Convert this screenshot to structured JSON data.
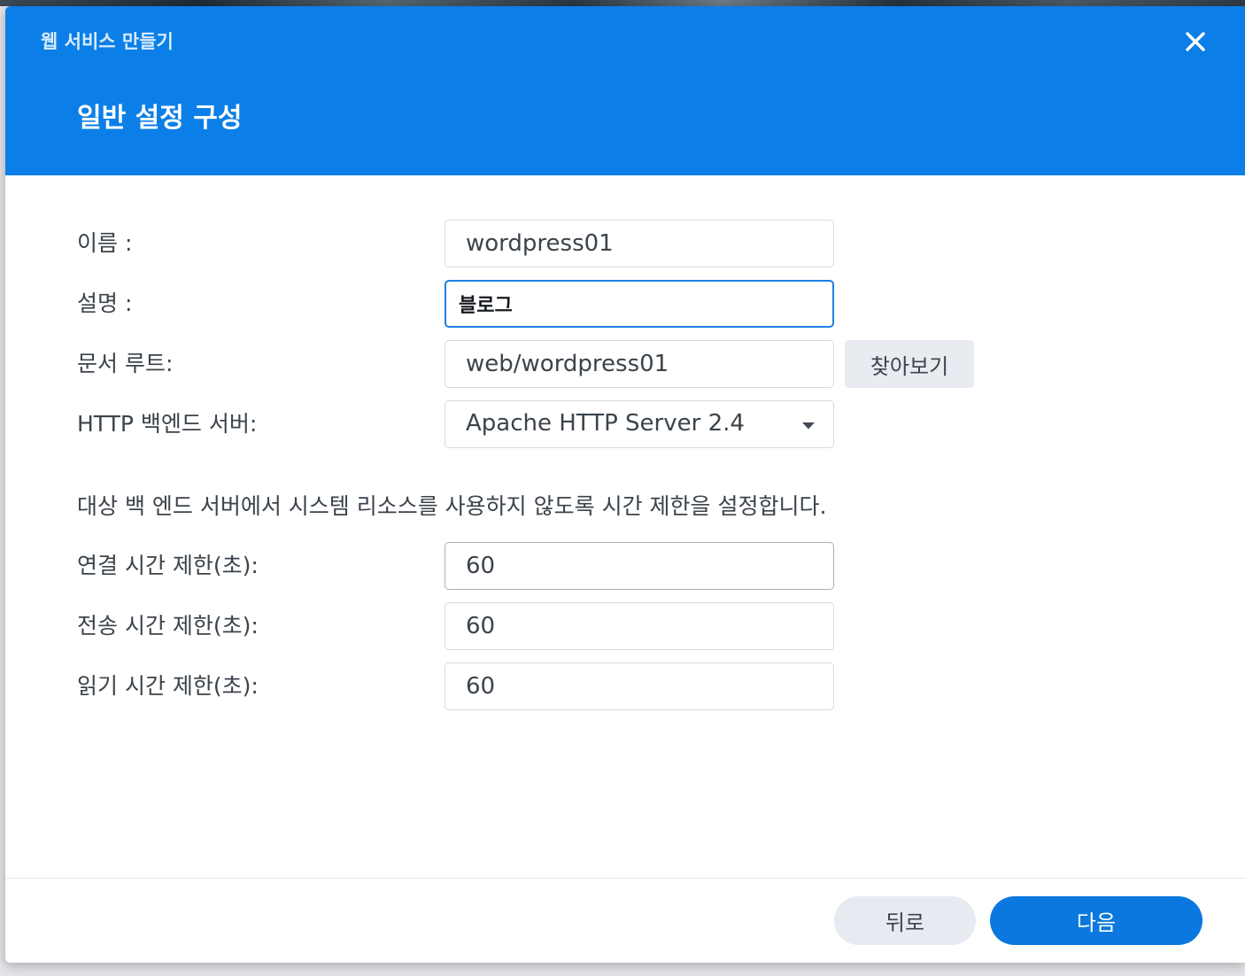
{
  "window": {
    "title": "웹 서비스 만들기"
  },
  "step": {
    "title": "일반 설정 구성"
  },
  "form": {
    "name": {
      "label": "이름 :",
      "value": "wordpress01"
    },
    "description": {
      "label": "설명 :",
      "value": "블로그"
    },
    "document_root": {
      "label": "문서 루트:",
      "value": "web/wordpress01",
      "browse_label": "찾아보기"
    },
    "http_backend": {
      "label": "HTTP 백엔드 서버:",
      "value": "Apache HTTP Server 2.4"
    },
    "timeout_note": "대상 백 엔드 서버에서 시스템 리소스를 사용하지 않도록 시간 제한을 설정합니다.",
    "connect_timeout": {
      "label": "연결 시간 제한(초):",
      "value": "60"
    },
    "send_timeout": {
      "label": "전송 시간 제한(초):",
      "value": "60"
    },
    "read_timeout": {
      "label": "읽기 시간 제한(초):",
      "value": "60"
    }
  },
  "footer": {
    "back_label": "뒤로",
    "next_label": "다음"
  },
  "icons": {
    "close": "close-icon",
    "dropdown": "caret-down-icon"
  },
  "colors": {
    "header": "#0b7fe7",
    "primary_button": "#0a78de",
    "focus_border": "#1d7fe4"
  }
}
